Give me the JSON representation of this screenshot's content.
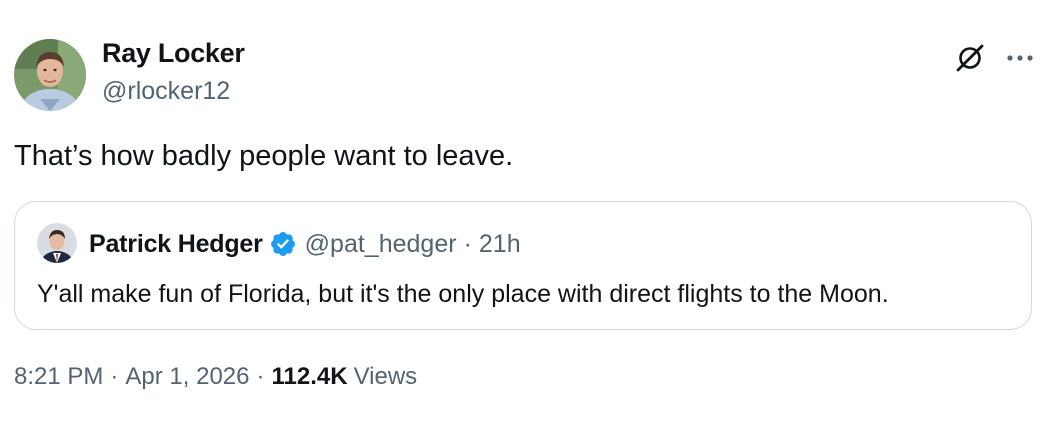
{
  "author": {
    "name": "Ray Locker",
    "handle": "@rlocker12"
  },
  "tweet": {
    "text": "That’s how badly people want to leave."
  },
  "quoted_tweet": {
    "name": "Patrick Hedger",
    "verified": true,
    "handle": "@pat_hedger",
    "separator": "·",
    "time": "21h",
    "text": "Y'all make fun of Florida, but it's the only place with direct flights to the Moon."
  },
  "meta": {
    "time": "8:21 PM",
    "separator": "·",
    "date": "Apr 1, 2026",
    "separator2": "·",
    "views_count": "112.4K",
    "views_label": "Views"
  },
  "icons": {
    "grok": "grok-icon",
    "more": "more-icon",
    "verified": "verified-badge-icon"
  },
  "colors": {
    "text_primary": "#0f1419",
    "text_secondary": "#536471",
    "border": "#cfd9de",
    "verified_blue": "#1d9bf0"
  }
}
